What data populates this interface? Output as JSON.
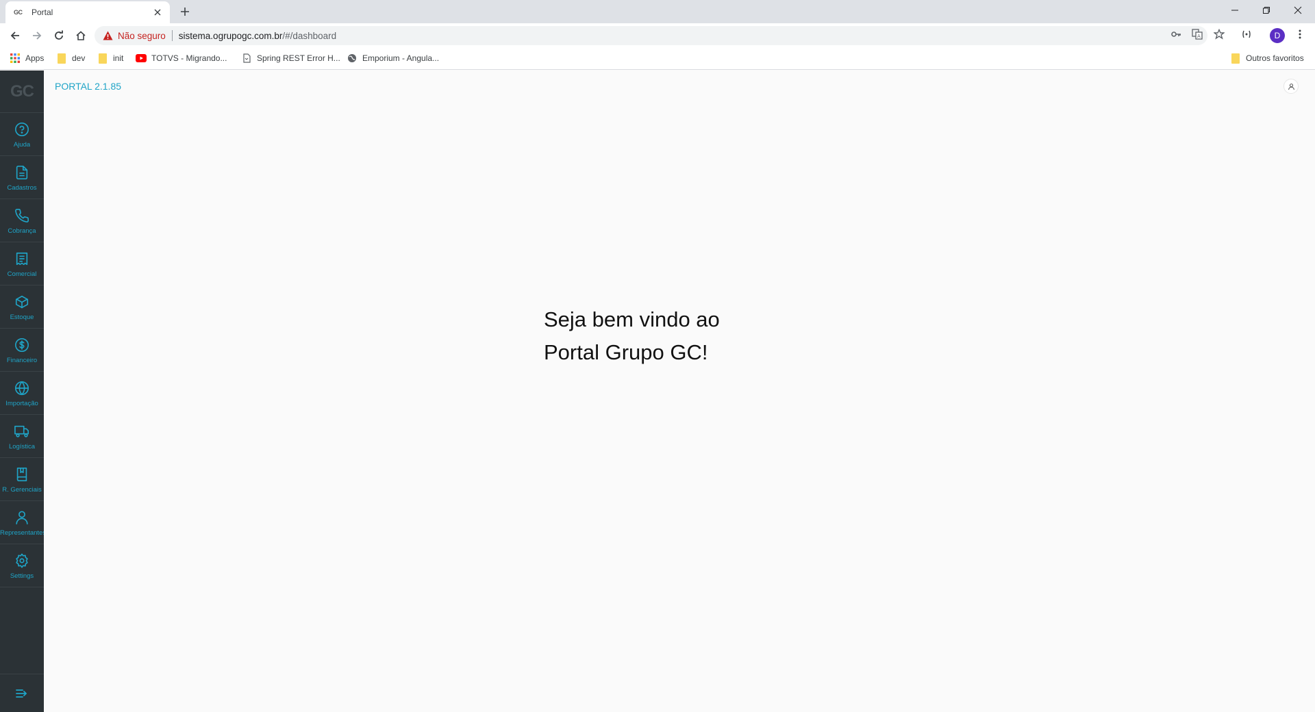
{
  "browser": {
    "tab": {
      "favicon": "GC",
      "title": "Portal"
    },
    "omnibox": {
      "security_label": "Não seguro",
      "url_host": "sistema.ogrupogc.com.br",
      "url_path": "/#/dashboard"
    },
    "profile_initial": "D",
    "bookmarks": [
      {
        "label": "Apps",
        "icon": "apps-grid-icon"
      },
      {
        "label": "dev",
        "icon": "folder-icon"
      },
      {
        "label": "init",
        "icon": "folder-icon"
      },
      {
        "label": "TOTVS - Migrando...",
        "icon": "youtube-icon"
      },
      {
        "label": "Spring REST Error H...",
        "icon": "page-icon"
      },
      {
        "label": "Emporium - Angula...",
        "icon": "globe-icon"
      }
    ],
    "other_bookmarks": "Outros favoritos"
  },
  "sidebar": {
    "logo": "GC",
    "items": [
      {
        "label": "Ajuda",
        "icon": "help-icon"
      },
      {
        "label": "Cadastros",
        "icon": "document-icon"
      },
      {
        "label": "Cobrança",
        "icon": "phone-icon"
      },
      {
        "label": "Comercial",
        "icon": "receipt-icon"
      },
      {
        "label": "Estoque",
        "icon": "box-icon"
      },
      {
        "label": "Financeiro",
        "icon": "dollar-icon"
      },
      {
        "label": "Importação",
        "icon": "globe-icon"
      },
      {
        "label": "Logística",
        "icon": "truck-icon"
      },
      {
        "label": "R. Gerenciais",
        "icon": "book-icon"
      },
      {
        "label": "Representantes",
        "icon": "user-icon"
      },
      {
        "label": "Settings",
        "icon": "gear-icon"
      }
    ]
  },
  "main": {
    "version": "PORTAL 2.1.85",
    "welcome_line1": "Seja bem vindo ao",
    "welcome_line2": "Portal Grupo GC!"
  },
  "colors": {
    "accent": "#1fa4c7",
    "sidebar_bg": "#2b3236",
    "warning": "#c5221f"
  }
}
